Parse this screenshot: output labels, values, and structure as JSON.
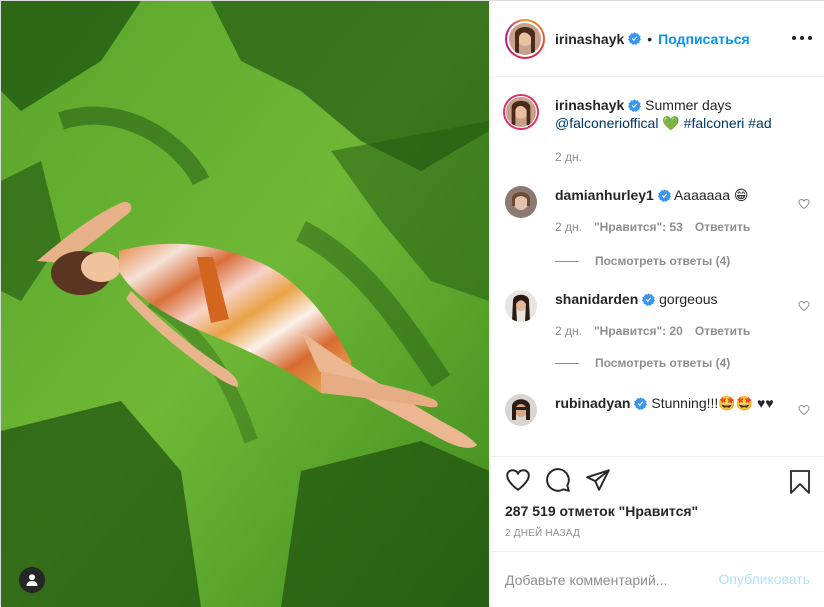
{
  "post": {
    "username": "irinashayk",
    "follow_label": "Подписаться",
    "separator": "•",
    "caption": {
      "text": "Summer days",
      "mention": "@falconerioffical",
      "heart": "💚",
      "hashtags": "#falconeri #ad",
      "time": "2 дн."
    }
  },
  "comments": [
    {
      "username": "damianhurley1",
      "text": "Aaaaaaa 😁",
      "time": "2 дн.",
      "likes": "\"Нравится\": 53",
      "reply": "Ответить",
      "view_replies": "Посмотреть ответы (4)"
    },
    {
      "username": "shanidarden",
      "text": "gorgeous",
      "time": "2 дн.",
      "likes": "\"Нравится\": 20",
      "reply": "Ответить",
      "view_replies": "Посмотреть ответы (4)"
    },
    {
      "username": "rubinadyan",
      "text": "Stunning!!!🤩🤩 ♥♥"
    }
  ],
  "stats": {
    "likes": "287 519 отметок \"Нравится\"",
    "date": "2 ДНЕЙ НАЗАД"
  },
  "composer": {
    "placeholder": "Добавьте комментарий...",
    "publish_label": "Опубликовать"
  },
  "icons": {
    "verified": "verified-badge-icon",
    "like": "heart-icon",
    "comment": "comment-icon",
    "share": "paper-plane-icon",
    "save": "bookmark-icon",
    "more": "more-options-icon",
    "tagged": "user-tag-icon"
  },
  "colors": {
    "link_blue": "#0095f6",
    "publish_disabled": "#b2dffc",
    "mention": "#00376b",
    "muted": "#8e8e8e"
  }
}
